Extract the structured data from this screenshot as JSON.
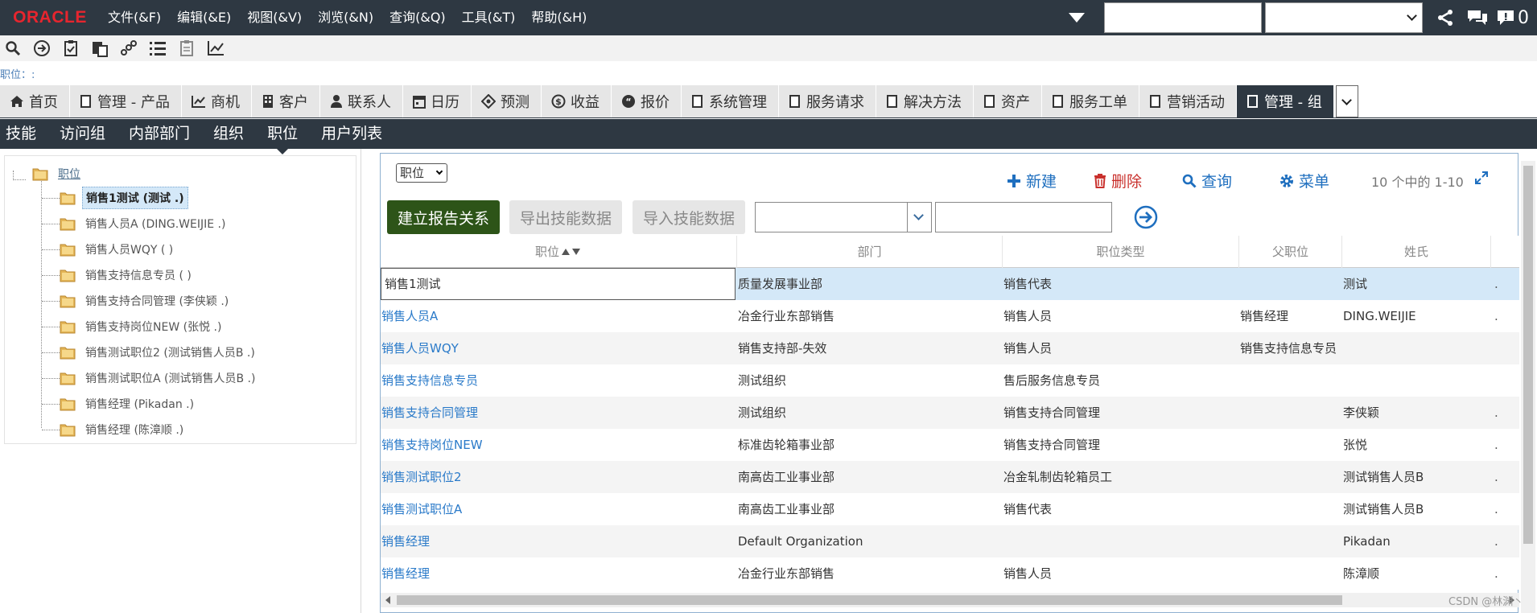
{
  "brand": {
    "logo_text": "ORACLE"
  },
  "menubar": {
    "items": [
      "文件(&F)",
      "编辑(&E)",
      "视图(&V)",
      "浏览(&N)",
      "查询(&Q)",
      "工具(&T)",
      "帮助(&H)"
    ],
    "notification_count": "0"
  },
  "position_line": "职位：:",
  "screen_tabs": [
    {
      "label": "首页",
      "icon": "home-icon"
    },
    {
      "label": "管理 - 产品",
      "icon": "page-icon"
    },
    {
      "label": "商机",
      "icon": "chart-icon"
    },
    {
      "label": "客户",
      "icon": "building-icon"
    },
    {
      "label": "联系人",
      "icon": "person-icon"
    },
    {
      "label": "日历",
      "icon": "calendar-icon"
    },
    {
      "label": "预测",
      "icon": "target-icon"
    },
    {
      "label": "收益",
      "icon": "dollar-icon"
    },
    {
      "label": "报价",
      "icon": "quote-icon"
    },
    {
      "label": "系统管理",
      "icon": "page-icon"
    },
    {
      "label": "服务请求",
      "icon": "page-icon"
    },
    {
      "label": "解决方法",
      "icon": "page-icon"
    },
    {
      "label": "资产",
      "icon": "page-icon"
    },
    {
      "label": "服务工单",
      "icon": "page-icon"
    },
    {
      "label": "营销活动",
      "icon": "page-icon"
    },
    {
      "label": "管理 - 组",
      "icon": "page-icon",
      "active": true
    }
  ],
  "view_links": [
    "技能",
    "访问组",
    "内部部门",
    "组织",
    "职位",
    "用户列表"
  ],
  "active_view": "职位",
  "tree": {
    "root": "职位",
    "items": [
      "销售1测试 (测试 .)",
      "销售人员A (DING.WEIJIE .)",
      "销售人员WQY ( )",
      "销售支持信息专员 ( )",
      "销售支持合同管理 (李侠颖 .)",
      "销售支持岗位NEW (张悦 .)",
      "销售测试职位2 (测试销售人员B .)",
      "销售测试职位A (测试销售人员B .)",
      "销售经理 (Pikadan .)",
      "销售经理 (陈漳顺 .)"
    ],
    "selected_index": 0
  },
  "applet": {
    "select_value": "职位",
    "actions": {
      "new": "新建",
      "delete": "删除",
      "query": "查询",
      "menu": "菜单"
    },
    "record_count": "10 个中的 1-10",
    "buttons": {
      "report": "建立报告关系",
      "export": "导出技能数据",
      "import": "导入技能数据"
    },
    "columns": [
      "职位",
      "部门",
      "职位类型",
      "父职位",
      "姓氏"
    ],
    "rows": [
      {
        "position": "销售1测试",
        "dept": "质量发展事业部",
        "type": "销售代表",
        "parent": "",
        "last": "测试",
        "dot": "."
      },
      {
        "position": "销售人员A",
        "dept": "冶金行业东部销售",
        "type": "销售人员",
        "parent": "销售经理",
        "last": "DING.WEIJIE",
        "dot": "."
      },
      {
        "position": "销售人员WQY",
        "dept": "销售支持部-失效",
        "type": "销售人员",
        "parent": "销售支持信息专员",
        "last": "",
        "dot": ""
      },
      {
        "position": "销售支持信息专员",
        "dept": "测试组织",
        "type": "售后服务信息专员",
        "parent": "",
        "last": "",
        "dot": ""
      },
      {
        "position": "销售支持合同管理",
        "dept": "测试组织",
        "type": "销售支持合同管理",
        "parent": "",
        "last": "李侠颖",
        "dot": "."
      },
      {
        "position": "销售支持岗位NEW",
        "dept": "标准齿轮箱事业部",
        "type": "销售支持合同管理",
        "parent": "",
        "last": "张悦",
        "dot": "."
      },
      {
        "position": "销售测试职位2",
        "dept": "南高齿工业事业部",
        "type": "冶金轧制齿轮箱员工",
        "parent": "",
        "last": "测试销售人员B",
        "dot": "."
      },
      {
        "position": "销售测试职位A",
        "dept": "南高齿工业事业部",
        "type": "销售代表",
        "parent": "",
        "last": "测试销售人员B",
        "dot": "."
      },
      {
        "position": "销售经理",
        "dept": "Default Organization",
        "type": "",
        "parent": "",
        "last": "Pikadan",
        "dot": "."
      },
      {
        "position": "销售经理",
        "dept": "冶金行业东部销售",
        "type": "销售人员",
        "parent": "",
        "last": "陈漳顺",
        "dot": "."
      }
    ]
  },
  "watermark": "CSDN @林渊丶",
  "colors": {
    "menubar_bg": "#2e3842",
    "logo_red": "#e7252e",
    "link_blue": "#2a7ac9",
    "report_btn": "#2d5418",
    "selection": "#d4e8f8"
  }
}
